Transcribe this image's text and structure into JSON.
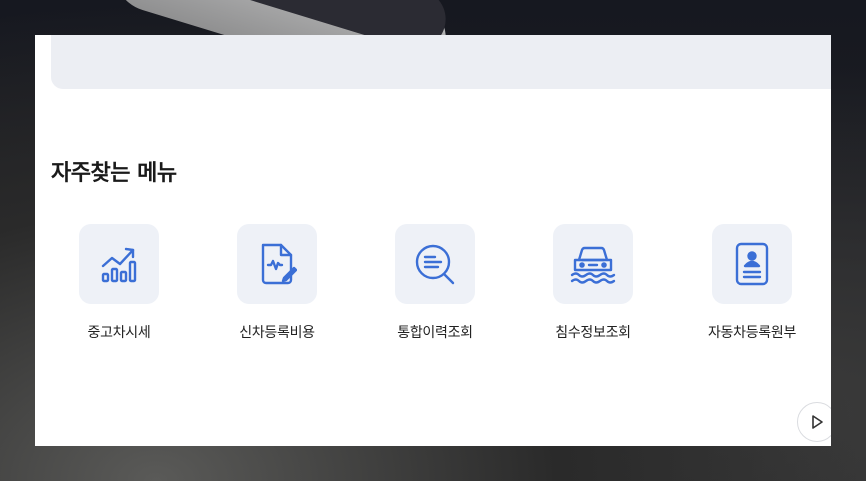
{
  "section": {
    "title": "자주찾는 메뉴"
  },
  "menu": [
    {
      "label": "중고차시세",
      "icon": "price-trend-icon"
    },
    {
      "label": "신차등록비용",
      "icon": "document-sign-icon"
    },
    {
      "label": "통합이력조회",
      "icon": "search-list-icon"
    },
    {
      "label": "침수정보조회",
      "icon": "flooded-car-icon"
    },
    {
      "label": "자동차등록원부",
      "icon": "id-card-icon"
    }
  ],
  "colors": {
    "accent": "#3b6fd6",
    "icon_bg": "#eef1f7"
  },
  "nav": {
    "next_icon": "play-arrow-icon"
  }
}
